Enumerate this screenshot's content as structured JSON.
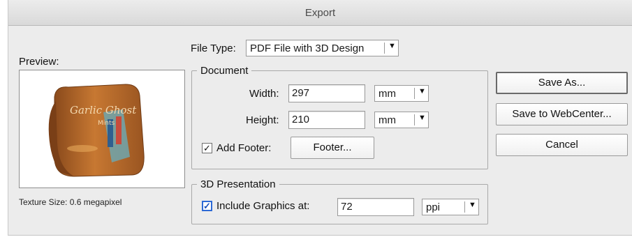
{
  "window": {
    "title": "Export"
  },
  "file_type": {
    "label": "File Type:",
    "value": "PDF File with 3D Design"
  },
  "preview": {
    "label": "Preview:",
    "texture_size": "Texture Size: 0.6 megapixel",
    "package_text": "Garlic Ghost",
    "package_subtext": "Mints"
  },
  "document": {
    "legend": "Document",
    "width_label": "Width:",
    "width_value": "297",
    "width_unit": "mm",
    "height_label": "Height:",
    "height_value": "210",
    "height_unit": "mm",
    "add_footer_label": "Add Footer:",
    "add_footer_checked": true,
    "footer_button": "Footer..."
  },
  "presentation": {
    "legend": "3D Presentation",
    "include_label": "Include Graphics at:",
    "include_checked": true,
    "resolution_value": "72",
    "resolution_unit": "ppi"
  },
  "buttons": {
    "save_as": "Save As...",
    "save_webcenter": "Save to WebCenter...",
    "cancel": "Cancel"
  },
  "icons": {
    "dropdown": "▼",
    "checkmark": "✓"
  },
  "colors": {
    "accent": "#2d6ad6",
    "package": "#b8642a"
  }
}
